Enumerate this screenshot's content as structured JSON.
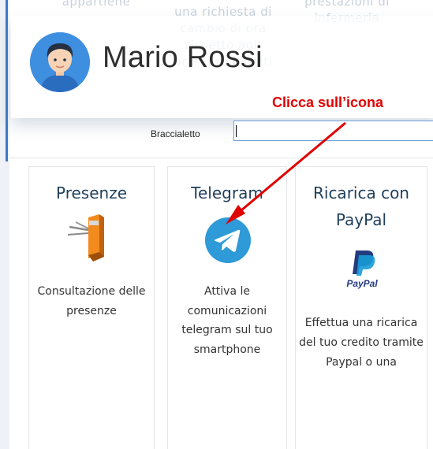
{
  "background_fragments": {
    "left": "appartiene",
    "middle": "una richiesta di cambio di ora rispetto agli orari predefiniti",
    "right": "prestazioni di infermeria"
  },
  "header": {
    "user_name": "Mario Rossi",
    "avatar": "user-avatar"
  },
  "form": {
    "braccialetto_label": "Braccialetto",
    "braccialetto_value": ""
  },
  "annotation": {
    "text": "Clicca sull’icona",
    "color": "#e30000"
  },
  "tiles": [
    {
      "title": "Presenze",
      "icon": "turnstile-icon",
      "description": "Consultazione delle presenze"
    },
    {
      "title": "Telegram",
      "icon": "telegram-icon",
      "description": "Attiva le comunicazioni telegram sul tuo smartphone"
    },
    {
      "title": "Ricarica con PayPal",
      "icon": "paypal-icon",
      "icon_text": "PayPal",
      "description": "Effettua una ricarica del tuo credito tramite Paypal o una"
    }
  ],
  "colors": {
    "tile_title": "#1f3f5a",
    "telegram": "#2e9ad8",
    "accent": "#3a7bc8"
  }
}
